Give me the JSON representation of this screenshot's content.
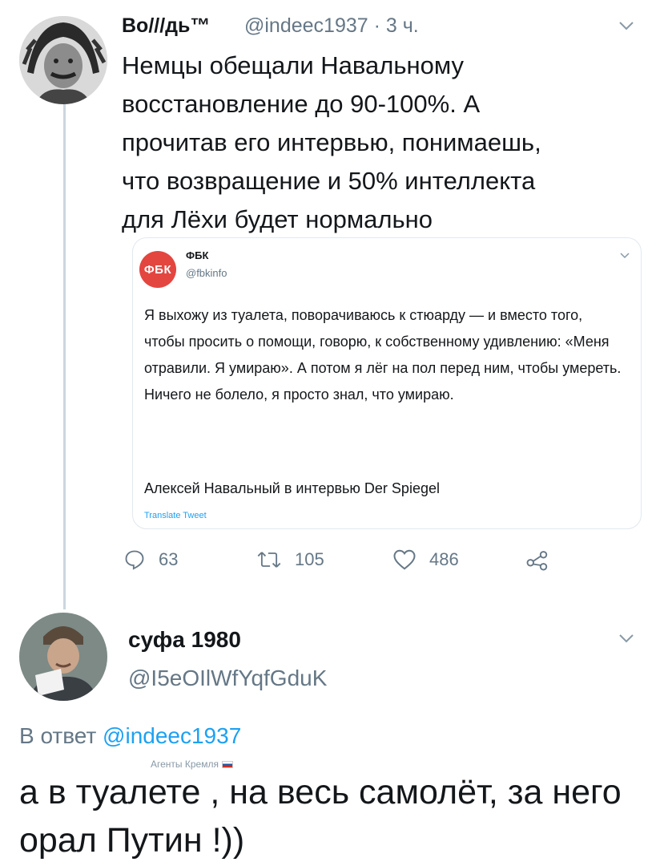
{
  "tweet": {
    "author_name": "Во///дь™",
    "author_handle": "@indeec1937 · 3 ч.",
    "text": "Немцы обещали Навальному\nвосстановление до 90-100%. А\nпрочитав его интервью, понимаешь,\nчто возвращение и 50% интеллекта\nдля Лёхи будет нормально",
    "quoted": {
      "logo_text": "ФБК",
      "name": "ФБК",
      "handle": "@fbkinfo",
      "text": "Я выхожу из туалета, поворачиваюсь к стюарду — и вместо того, чтобы просить о помощи, говорю, к собственному удивлению: «Меня отравили. Я умираю». А потом я лёг на пол перед ним, чтобы умереть. Ничего не болело, я просто знал, что умираю.",
      "signature": "Алексей Навальный в интервью Der Spiegel",
      "translate_label": "Translate Tweet"
    },
    "actions": {
      "replies": "63",
      "retweets": "105",
      "likes": "486"
    }
  },
  "reply": {
    "author_name": "суфа 1980",
    "author_handle": "@I5eOIlWfYqfGduK",
    "reply_prefix": "В ответ ",
    "reply_to": "@indeec1937",
    "watermark": "Агенты Кремля",
    "text": "а в туалете , на весь самолёт, за него орал Путин !))"
  },
  "icons": {
    "reply": "reply-icon",
    "retweet": "retweet-icon",
    "like": "heart-icon",
    "share": "share-icon",
    "more": "chevron-down-icon"
  },
  "colors": {
    "text": "#14171a",
    "muted": "#657786",
    "link": "#1da1f2",
    "fbk_red": "#e3463f",
    "border": "#e1e8ed"
  }
}
